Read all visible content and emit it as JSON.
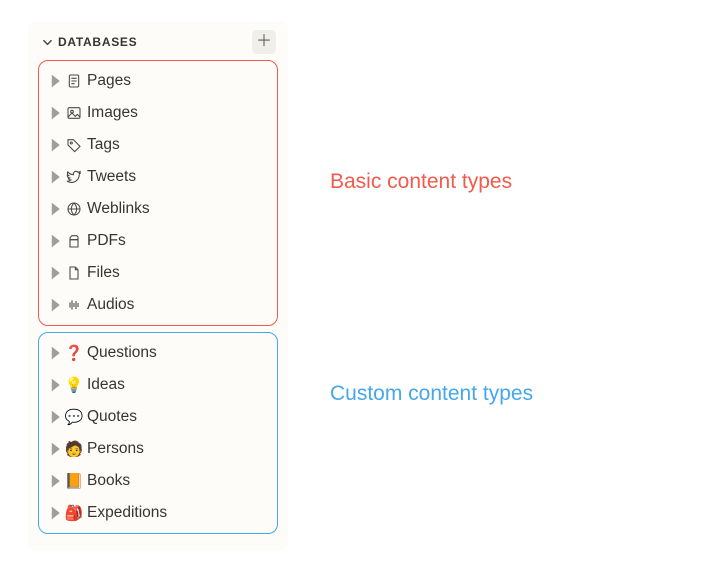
{
  "header": {
    "title": "DATABASES"
  },
  "groups": [
    {
      "kind": "basic",
      "items": [
        {
          "name": "pages",
          "label": "Pages",
          "icon": "page-icon"
        },
        {
          "name": "images",
          "label": "Images",
          "icon": "image-icon"
        },
        {
          "name": "tags",
          "label": "Tags",
          "icon": "tag-icon"
        },
        {
          "name": "tweets",
          "label": "Tweets",
          "icon": "twitter-icon"
        },
        {
          "name": "weblinks",
          "label": "Weblinks",
          "icon": "globe-icon"
        },
        {
          "name": "pdfs",
          "label": "PDFs",
          "icon": "pdf-icon"
        },
        {
          "name": "files",
          "label": "Files",
          "icon": "file-icon"
        },
        {
          "name": "audios",
          "label": "Audios",
          "icon": "audio-icon"
        }
      ]
    },
    {
      "kind": "custom",
      "items": [
        {
          "name": "questions",
          "label": "Questions",
          "emoji": "❓"
        },
        {
          "name": "ideas",
          "label": "Ideas",
          "emoji": "💡"
        },
        {
          "name": "quotes",
          "label": "Quotes",
          "emoji": "💬"
        },
        {
          "name": "persons",
          "label": "Persons",
          "emoji": "🧑"
        },
        {
          "name": "books",
          "label": "Books",
          "emoji": "📙"
        },
        {
          "name": "expeditions",
          "label": "Expeditions",
          "emoji": "🎒"
        }
      ]
    }
  ],
  "annotations": {
    "basic": "Basic content types",
    "custom": "Custom content types"
  },
  "colors": {
    "red": "#f25a4b",
    "blue": "#46a7ed"
  }
}
